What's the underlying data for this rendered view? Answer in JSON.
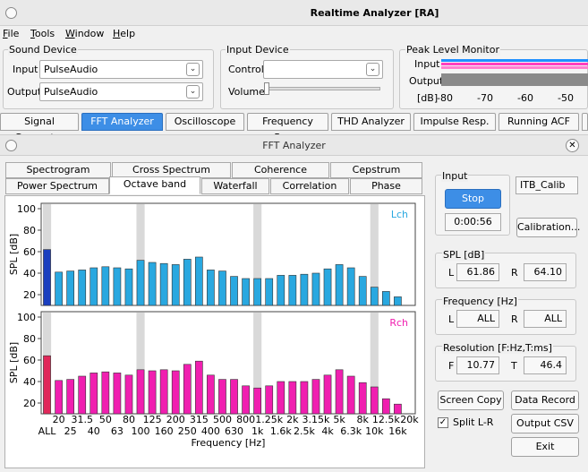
{
  "window": {
    "title": "Realtime Analyzer [RA]"
  },
  "menu": [
    {
      "label": "File",
      "key": "F",
      "rest": "ile"
    },
    {
      "label": "Tools",
      "key": "T",
      "rest": "ools"
    },
    {
      "label": "Window",
      "key": "W",
      "rest": "indow"
    },
    {
      "label": "Help",
      "key": "H",
      "rest": "elp"
    }
  ],
  "sound_device": {
    "group_label": "Sound Device",
    "input_label": "Input",
    "input_value": "PulseAudio",
    "output_label": "Output",
    "output_value": "PulseAudio"
  },
  "input_device": {
    "group_label": "Input Device",
    "control_label": "Control",
    "control_value": "",
    "volume_label": "Volume",
    "volume_level": 0
  },
  "peak_level": {
    "group_label": "Peak Level Monitor",
    "input_label": "Input",
    "output_label": "Output",
    "scale_unit": "[dB]",
    "scale": [
      "-80",
      "-70",
      "-60",
      "-50"
    ],
    "colors": {
      "input_l": "#1e90ff",
      "input_r": "#ff3fbf",
      "output": "#808080"
    }
  },
  "tool_tabs": [
    "Signal Generator",
    "FFT Analyzer",
    "Oscilloscope",
    "Frequency Resp.",
    "THD Analyzer",
    "Impulse Resp.",
    "Running ACF"
  ],
  "tool_tabs_selected": 1,
  "fft": {
    "title": "FFT Analyzer",
    "tabs_row1": [
      "Spectrogram",
      "Cross Spectrum",
      "Coherence",
      "Cepstrum"
    ],
    "tabs_row2": [
      "Power Spectrum",
      "Octave band",
      "Waterfall",
      "Correlation",
      "Phase"
    ],
    "tabs_row2_selected": 1
  },
  "controls": {
    "input_label": "Input",
    "stop_label": "Stop",
    "elapsed": "0:00:56",
    "calib_name": "ITB_Calib",
    "calibration_label": "Calibration...",
    "spl_label": "SPL [dB]",
    "spl_l_label": "L",
    "spl_l": "61.86",
    "spl_r_label": "R",
    "spl_r": "64.10",
    "freq_label": "Frequency [Hz]",
    "freq_l_label": "L",
    "freq_l": "ALL",
    "freq_r_label": "R",
    "freq_r": "ALL",
    "res_label": "Resolution [F:Hz,T:ms]",
    "res_f_label": "F",
    "res_f": "10.77",
    "res_t_label": "T",
    "res_t": "46.4",
    "screen_copy": "Screen Copy",
    "data_record": "Data Record",
    "split_lr": "Split L-R",
    "split_lr_checked": true,
    "output_csv": "Output CSV",
    "exit": "Exit"
  },
  "chart_data": {
    "type": "bar",
    "xlabel": "Frequency [Hz]",
    "ylabel": "SPL [dB]",
    "ylim": [
      10,
      105
    ],
    "yticks": [
      "20",
      "40",
      "60",
      "80",
      "100"
    ],
    "categories": [
      "ALL",
      "20",
      "25",
      "31.5",
      "40",
      "50",
      "63",
      "80",
      "100",
      "125",
      "160",
      "200",
      "250",
      "315",
      "400",
      "500",
      "630",
      "800",
      "1k",
      "1.25k",
      "1.6k",
      "2k",
      "2.5k",
      "3.15k",
      "4k",
      "5k",
      "6.3k",
      "8k",
      "10k",
      "12.5k",
      "16k",
      "20k"
    ],
    "tick_labels_upper": [
      "20",
      "31.5",
      "50",
      "80",
      "125",
      "200",
      "315",
      "500",
      "800",
      "1.25k",
      "2k",
      "3.15k",
      "5k",
      "8k",
      "12.5k",
      "20k"
    ],
    "tick_labels_lower": [
      "ALL",
      "25",
      "40",
      "63",
      "100",
      "160",
      "250",
      "400",
      "630",
      "1k",
      "1.6k",
      "2.5k",
      "4k",
      "6.3k",
      "10k",
      "16k"
    ],
    "series": [
      {
        "name": "Lch",
        "color": "#29a8e0",
        "all_color": "#1a3fbf",
        "values": [
          62,
          41,
          42,
          43,
          45,
          46,
          45,
          44,
          52,
          50,
          49,
          48,
          53,
          55,
          43,
          42,
          37,
          35,
          35,
          35,
          38,
          38,
          39,
          40,
          44,
          48,
          45,
          37,
          27,
          23,
          18,
          null
        ]
      },
      {
        "name": "Rch",
        "color": "#f01fb0",
        "all_color": "#e0285a",
        "values": [
          64,
          41,
          42,
          45,
          48,
          49,
          48,
          46,
          51,
          50,
          51,
          50,
          56,
          59,
          46,
          42,
          42,
          36,
          34,
          36,
          40,
          40,
          40,
          42,
          46,
          51,
          45,
          39,
          35,
          24,
          19,
          null
        ]
      }
    ]
  }
}
